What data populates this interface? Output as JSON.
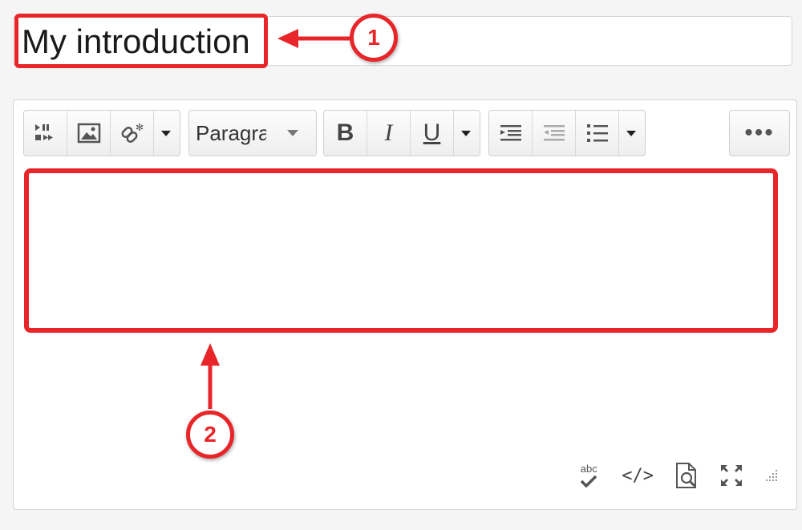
{
  "title_field": {
    "value": "My introduction"
  },
  "toolbar": {
    "format_select": "Paragra",
    "bold_label": "B",
    "italic_label": "I",
    "underline_label": "U",
    "more_label": "•••"
  },
  "status_bar": {
    "spellcheck_label": "abc",
    "source_code_label": "</>"
  },
  "callouts": {
    "one": "1",
    "two": "2"
  },
  "colors": {
    "highlight": "#e8262a"
  }
}
